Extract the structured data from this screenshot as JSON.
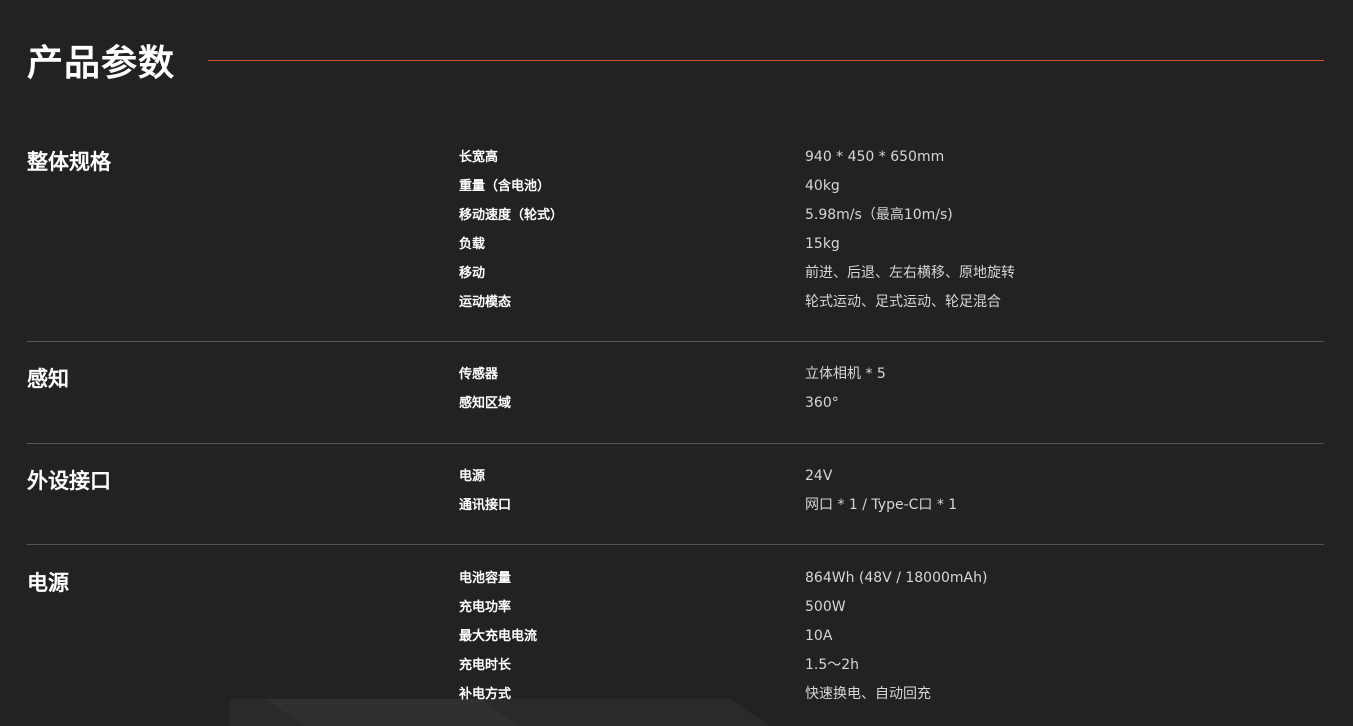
{
  "page": {
    "title": "产品参数",
    "accent_color": "#d0522c"
  },
  "sections": [
    {
      "title": "整体规格",
      "specs": [
        {
          "label": "长宽高",
          "value": "940 * 450 * 650mm"
        },
        {
          "label": "重量（含电池）",
          "value": "40kg"
        },
        {
          "label": "移动速度（轮式）",
          "value": "5.98m/s（最高10m/s)"
        },
        {
          "label": "负载",
          "value": "15kg"
        },
        {
          "label": "移动",
          "value": "前进、后退、左右横移、原地旋转"
        },
        {
          "label": "运动模态",
          "value": "轮式运动、足式运动、轮足混合"
        }
      ]
    },
    {
      "title": "感知",
      "specs": [
        {
          "label": "传感器",
          "value": "立体相机 * 5"
        },
        {
          "label": "感知区域",
          "value": "360°"
        }
      ]
    },
    {
      "title": "外设接口",
      "specs": [
        {
          "label": "电源",
          "value": "24V"
        },
        {
          "label": "通讯接口",
          "value": "网口 * 1 / Type-C口 * 1"
        }
      ]
    },
    {
      "title": "电源",
      "specs": [
        {
          "label": "电池容量",
          "value": "864Wh (48V / 18000mAh)"
        },
        {
          "label": "充电功率",
          "value": "500W"
        },
        {
          "label": "最大充电电流",
          "value": "10A"
        },
        {
          "label": "充电时长",
          "value": "1.5～2h"
        },
        {
          "label": "补电方式",
          "value": "快速换电、自动回充"
        }
      ]
    }
  ]
}
